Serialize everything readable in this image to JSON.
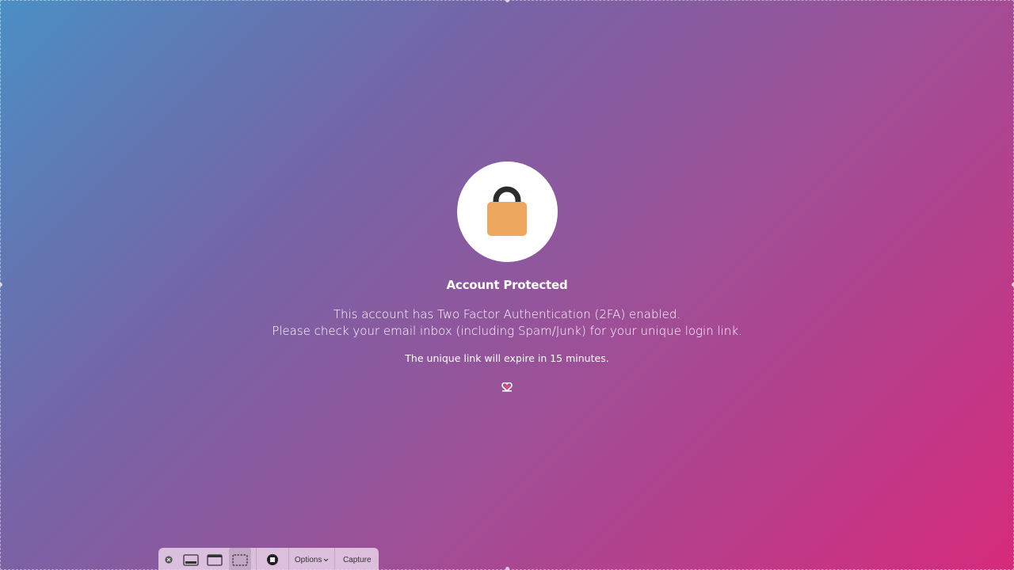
{
  "lock": {
    "icon": "padlock-icon",
    "body_color": "#eda75e",
    "shackle_color": "#2b2b2b"
  },
  "heading": "Account Protected",
  "message": {
    "line1": "This account has Two Factor Authentication (2FA) enabled.",
    "line2": "Please check your email inbox (including Spam/Junk) for your unique login link."
  },
  "expire_note": "The unique link will expire in 15 minutes.",
  "brand_icon": "heart-logo-icon",
  "toolbar": {
    "close_icon": "close-icon",
    "capture_screen_icon": "capture-entire-screen-icon",
    "capture_window_icon": "capture-window-icon",
    "capture_selection_icon": "capture-selection-icon",
    "record_icon": "record-stop-icon",
    "options_label": "Options",
    "capture_label": "Capture"
  }
}
